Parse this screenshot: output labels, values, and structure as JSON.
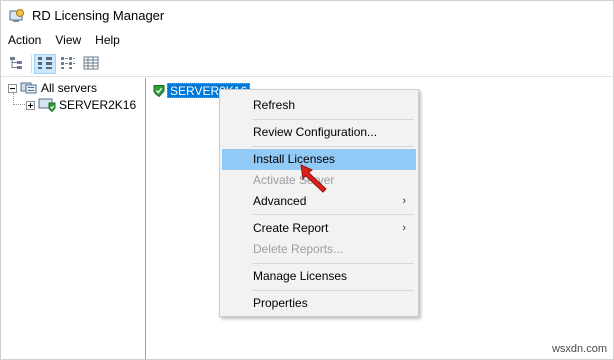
{
  "window": {
    "title": "RD Licensing Manager"
  },
  "menubar": {
    "items": [
      "Action",
      "View",
      "Help"
    ]
  },
  "toolbar": {
    "buttons": [
      "tree-view-icon",
      "large-icons-icon",
      "list-icon",
      "details-icon"
    ],
    "active": 1
  },
  "tree": {
    "root_label": "All servers",
    "child_label": "SERVER2K16"
  },
  "right_pane": {
    "selected_server": "SERVER2K16"
  },
  "context_menu": {
    "refresh": "Refresh",
    "review_configuration": "Review Configuration...",
    "install_licenses": "Install Licenses",
    "activate_server": "Activate Server",
    "advanced": "Advanced",
    "create_report": "Create Report",
    "delete_reports": "Delete Reports...",
    "manage_licenses": "Manage Licenses",
    "properties": "Properties",
    "highlighted_item": "Install Licenses",
    "disabled_items": [
      "Activate Server",
      "Delete Reports..."
    ]
  },
  "colors": {
    "selection_blue": "#0078d7",
    "menu_highlight": "#91c9f7",
    "cursor_red": "#e0201b",
    "server_shield_green": "#2e9e3a"
  },
  "watermark": "wsxdn.com"
}
